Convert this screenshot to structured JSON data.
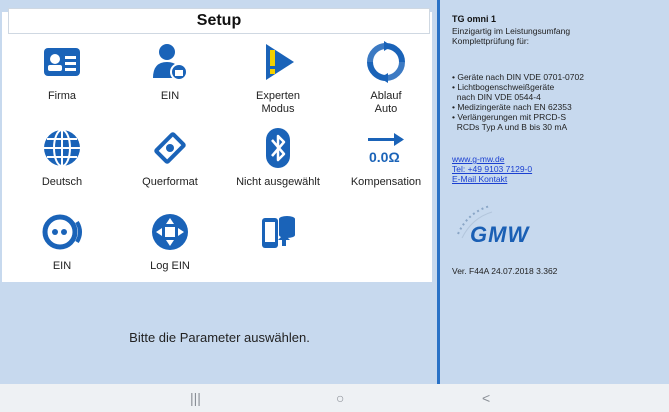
{
  "colors": {
    "accent": "#1a63b8",
    "background": "#c7d9ee",
    "link": "#1a3fd1"
  },
  "header": {
    "title": "Setup"
  },
  "tiles": [
    {
      "label": "Firma",
      "icon": "id-card-icon"
    },
    {
      "label": "EIN",
      "icon": "user-lock-icon"
    },
    {
      "label": "Experten",
      "label2": "Modus",
      "icon": "expert-warning-icon"
    },
    {
      "label": "Ablauf",
      "label2": "Auto",
      "icon": "refresh-icon"
    },
    {
      "label": "Deutsch",
      "icon": "globe-icon"
    },
    {
      "label": "Querformat",
      "icon": "rotate-device-icon"
    },
    {
      "label": "Nicht ausgewählt",
      "icon": "bluetooth-icon"
    },
    {
      "label": "Kompensation",
      "icon": "resistance-compensation-icon"
    },
    {
      "label": "EIN",
      "icon": "connection-icon"
    },
    {
      "label": "Log EIN",
      "icon": "log-icon"
    },
    {
      "label": "",
      "icon": "phone-database-icon"
    }
  ],
  "status": {
    "message": "Bitte die Parameter auswählen."
  },
  "info": {
    "title": "TG omni 1",
    "intro1": "Einzigartig im Leistungsumfang",
    "intro2": "Komplettprüfung für:",
    "b1": "• Geräte nach DIN VDE 0701-0702",
    "b2": "• Lichtbogenschweißgeräte",
    "b3": "  nach DIN VDE 0544-4",
    "b4": "• Medizingeräte nach EN 62353",
    "b5": "• Verlängerungen mit PRCD-S",
    "b6": "  RCDs Typ A und B bis 30 mA",
    "web": "www.g-mw.de",
    "tel": "Tel: +49 9103 7129-0",
    "mail": "E-Mail Kontakt",
    "logo_text": "GMW",
    "version": "Ver. F44A 24.07.2018 3.362"
  },
  "navbar": {
    "recent": "|||",
    "home": "○",
    "back": "<"
  }
}
